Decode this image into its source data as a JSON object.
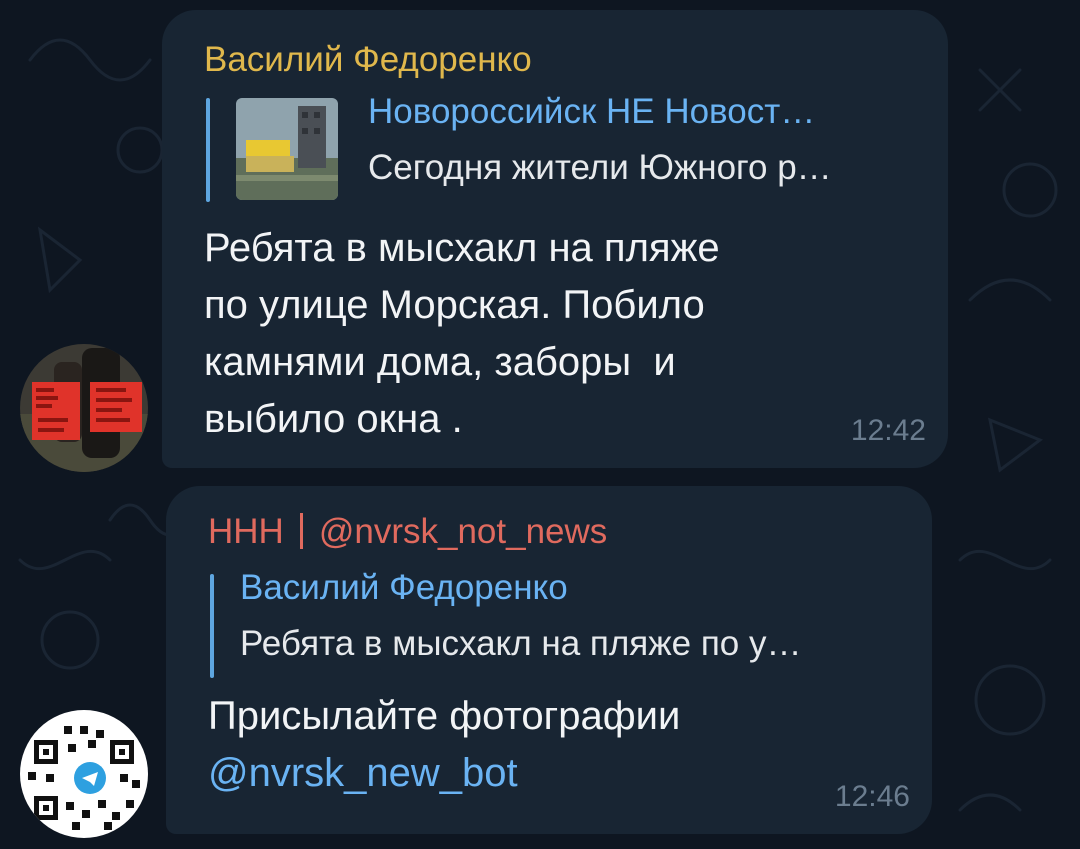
{
  "colors": {
    "background": "#0e1621",
    "bubble": "#182533",
    "sender_name": "#e0b84c",
    "forward_name": "#e06a5e",
    "link": "#6ab3f3",
    "time": "#6b7d8f"
  },
  "messages": [
    {
      "sender": "Василий Федоренко",
      "reply": {
        "title": "Новороссийск НЕ Новост…",
        "text": "Сегодня жители Южного р…",
        "has_thumbnail": true
      },
      "lines": [
        "Ребята в мысхакл на пляже",
        "по улице Морская. Побило",
        "камнями дома, заборы  и",
        "выбило окна ."
      ],
      "time": "12:42",
      "avatar": "avatar-end-of-the-world-image"
    },
    {
      "forward_name": "ННН",
      "forward_handle": "@nvrsk_not_news",
      "reply": {
        "title": "Василий Федоренко",
        "text": "Ребята в мысхакл на пляже по у…"
      },
      "lines": [
        "Присылайте фотографии"
      ],
      "link": "@nvrsk_new_bot",
      "time": "12:46",
      "avatar": "qr-code-avatar"
    }
  ]
}
